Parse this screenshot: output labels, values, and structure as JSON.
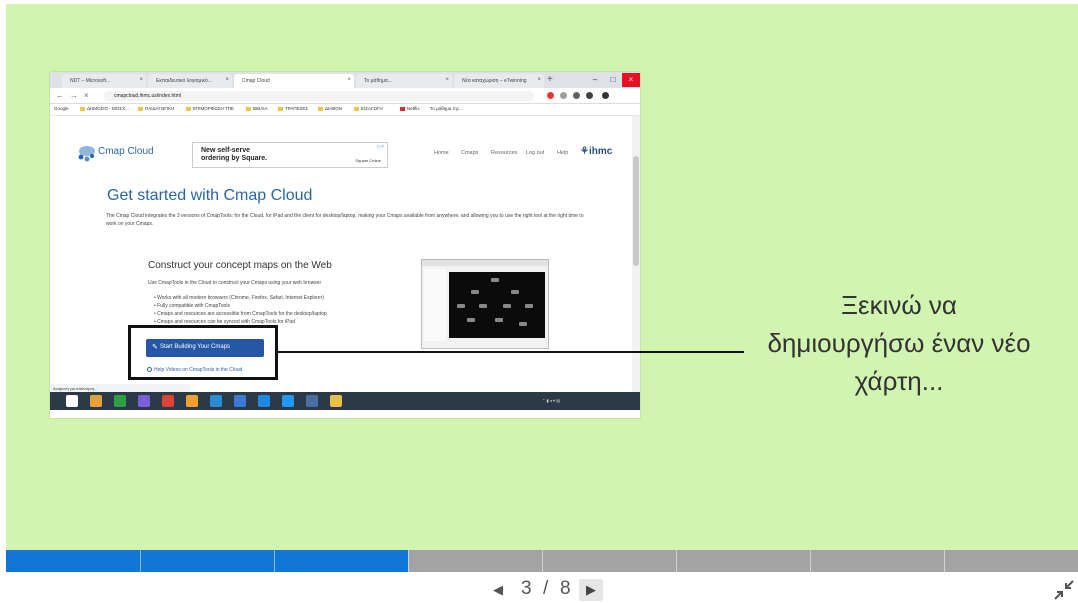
{
  "browser": {
    "tabs": [
      {
        "label": "NDT – Microsoft..."
      },
      {
        "label": "Εκπαιδευτικό λογισμικό..."
      },
      {
        "label": "Cmap Cloud"
      },
      {
        "label": "Το μάθημα..."
      },
      {
        "label": "Νέα καταχώριση – eTwinning"
      }
    ],
    "url": "cmapcloud.ihmc.us/index.html",
    "bookmarks": [
      "Google",
      "ΔΗΜΟΣΙΟ - ΜΟΣΧ...",
      "ΠΑΙΔΑΓΩΓΙΚΗ",
      "ΕΠΙΜΟΡΦΩΣΗ ΤΠΕ",
      "ΒΙΒΛΙΑ",
      "ΤΡΑΠΕΖΕΣ",
      "ΔΙΑΒΟΝ",
      "ΕΙΣΑΓΩΓΗ",
      "Netflix",
      "Το μάθημα της..."
    ],
    "status": "Αναμονή για απάντηση..."
  },
  "cmap": {
    "brand": "Cmap Cloud",
    "ad": {
      "line1": "New self-serve",
      "line2": "ordering by Square.",
      "brand": "Square Online"
    },
    "nav": [
      "Home",
      "Cmaps",
      "Resources",
      "Log out",
      "Help"
    ],
    "org": "ihmc",
    "headline": "Get started with Cmap Cloud",
    "intro": "The Cmap Cloud integrates the 3 versions of CmapTools: for the Cloud, for iPad and the client for desktop/laptop, making your Cmaps available from anywhere, and allowing you to use the right tool at the right time to work on your Cmaps.",
    "section_title": "Construct your concept maps on the Web",
    "section_sub": "Use CmapTools in the Cloud to construct your Cmaps using your web browser",
    "features": [
      "Works with all modern browsers (Chrome, Firefox, Safari, Internet Explorer)",
      "Fully compatible with CmapTools",
      "Cmaps and resources are accessible from CmapTools for the desktop/laptop",
      "Cmaps and resources can be synced with CmapTools for iPad"
    ],
    "start_button": "Start Building Your Cmaps",
    "help_link": "Help Videos on CmapTools in the Cloud"
  },
  "callout": {
    "line1": "Ξεκινώ να",
    "line2": "δημιουργήσω έναν νέο",
    "line3": "χάρτη..."
  },
  "progress": {
    "current": 3,
    "total": 8
  },
  "pager": {
    "current": "3",
    "separator": "/",
    "total": "8"
  },
  "colors": {
    "slide_bg": "#d1f4b1",
    "progress_done": "#1175d6",
    "progress_todo": "#a3a3a3",
    "cmap_blue": "#2a66a6",
    "button_blue": "#2457a5"
  },
  "icons": {
    "prev": "triangle-left-icon",
    "next": "triangle-right-icon",
    "collapse": "collapse-arrows-icon",
    "edit": "pencil-icon"
  }
}
